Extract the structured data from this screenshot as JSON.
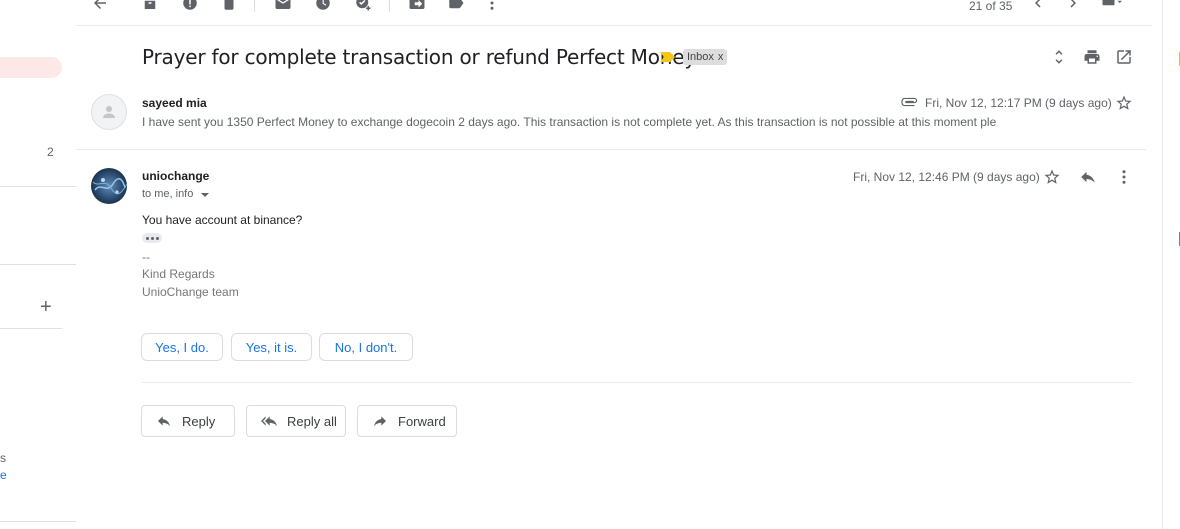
{
  "sidebar": {
    "unread_count": "2",
    "add_label_symbol": "+",
    "fragment_1": "s",
    "fragment_2": "e"
  },
  "toolbar": {
    "page_count": "21 of 35",
    "icons": [
      "back-arrow-icon",
      "archive-icon",
      "report-spam-icon",
      "delete-icon",
      "mark-unread-icon",
      "snooze-icon",
      "add-to-tasks-icon",
      "move-to-icon",
      "labels-icon",
      "more-vert-icon",
      "newer-chevron-icon",
      "older-chevron-icon",
      "keyboard-icon"
    ]
  },
  "thread": {
    "subject": "Prayer for complete transaction or refund Perfect Money.",
    "label": "Inbox",
    "label_remove": "x",
    "importance_color": "#f5c518"
  },
  "messages": [
    {
      "sender": "sayeed mia",
      "snippet": "I have sent you 1350 Perfect Money to exchange dogecoin 2 days ago. This transaction is not complete yet. As this transaction is not possible at this moment ple",
      "date": "Fri, Nov 12, 12:17 PM (9 days ago)"
    },
    {
      "sender": "uniochange",
      "recipients": "to me, info",
      "date": "Fri, Nov 12, 12:46 PM (9 days ago)",
      "body": "You have account at binance?",
      "signature_dash": "--",
      "signature_line_1": "Kind Regards",
      "signature_line_2": "UnioChange team"
    }
  ],
  "smart_replies": [
    "Yes, I do.",
    "Yes, it is.",
    "No, I don't."
  ],
  "actions": {
    "reply": "Reply",
    "reply_all": "Reply all",
    "forward": "Forward"
  },
  "colors": {
    "accent": "#1a73e8",
    "active_pill": "#fce8e6"
  }
}
